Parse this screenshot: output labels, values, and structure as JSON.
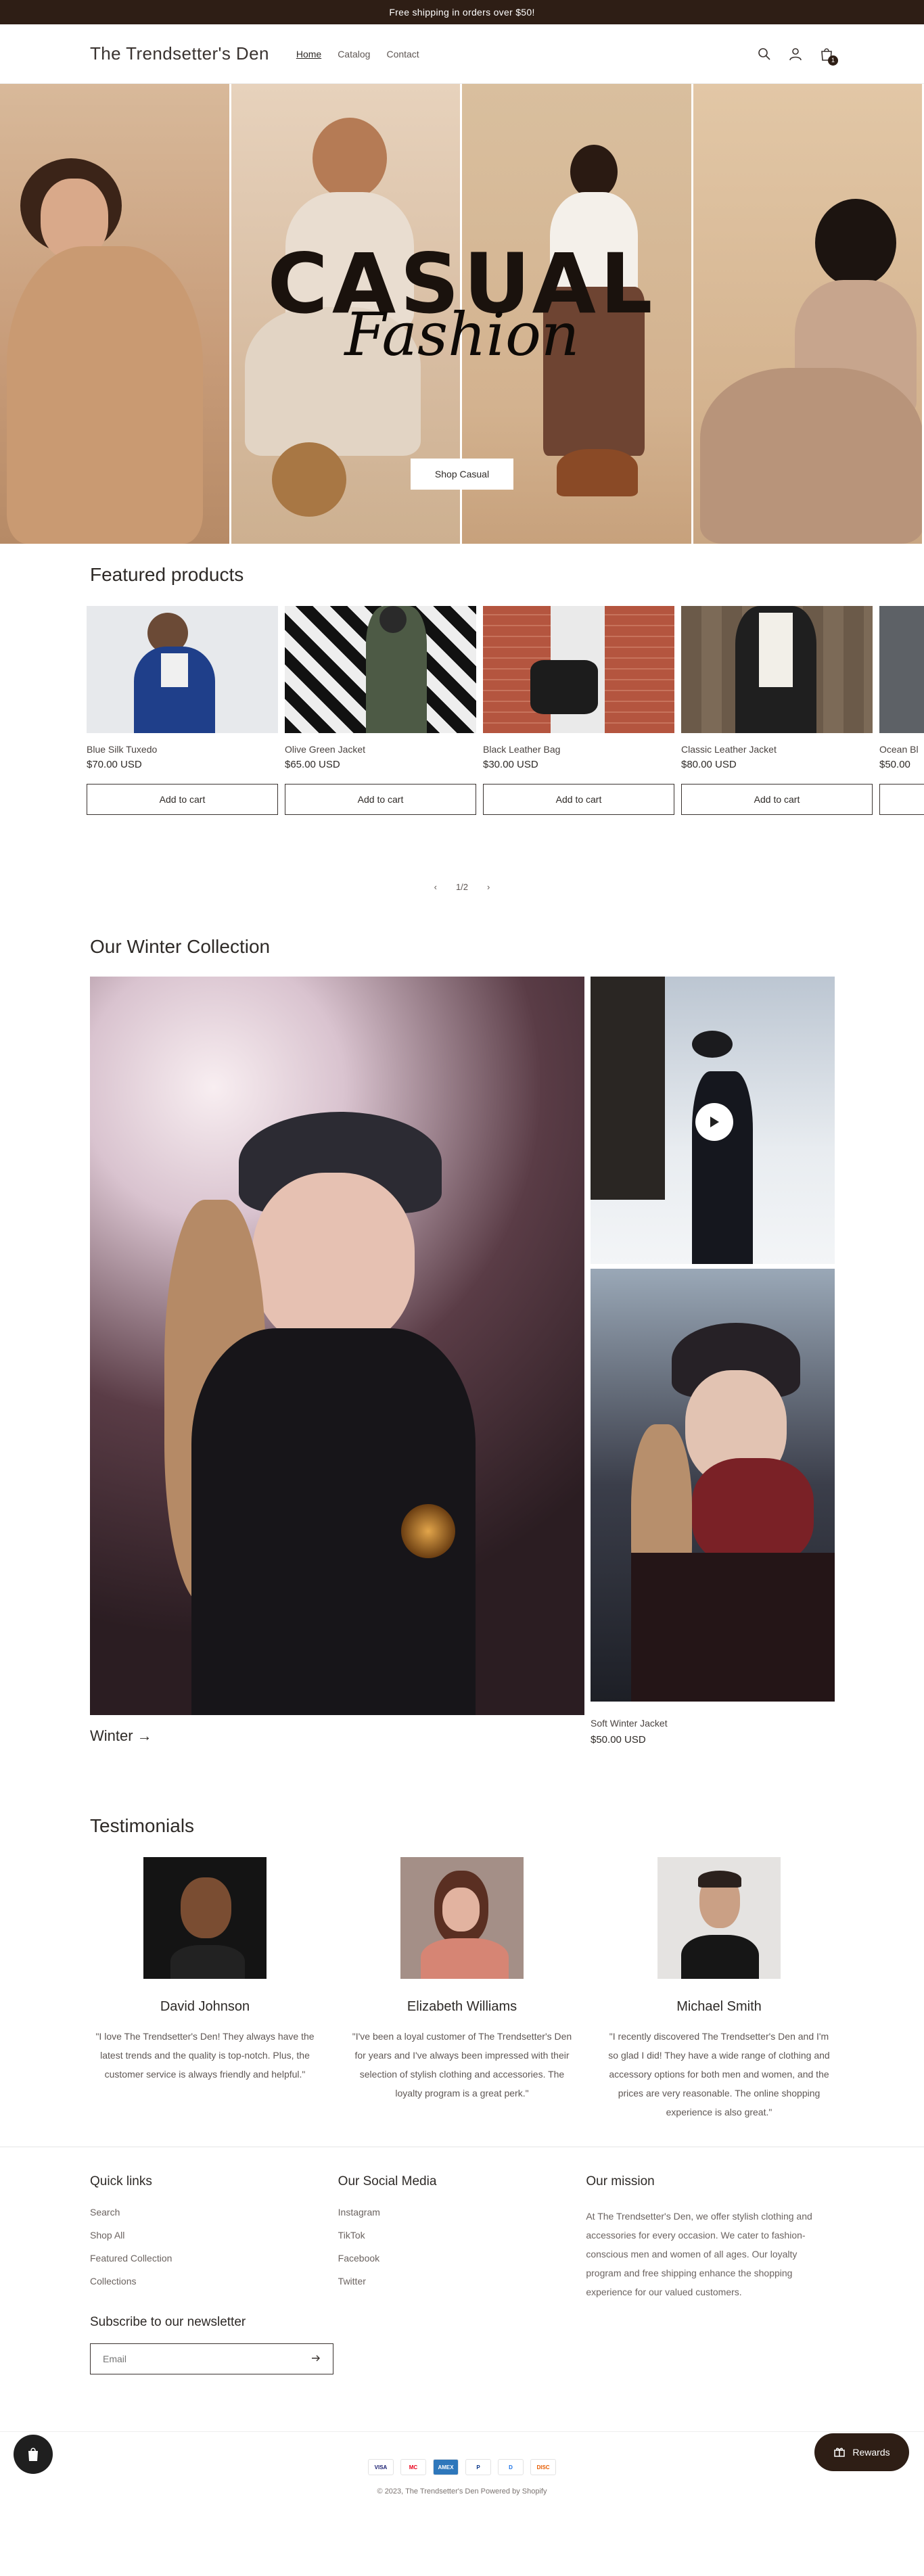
{
  "announcement": "Free shipping in orders over $50!",
  "header": {
    "brand": "The Trendsetter's Den",
    "nav": [
      "Home",
      "Catalog",
      "Contact"
    ],
    "cart_count": "1"
  },
  "hero": {
    "title": "CASUAL",
    "script": "Fashion",
    "button": "Shop Casual"
  },
  "featured": {
    "title": "Featured products",
    "products": [
      {
        "name": "Blue Silk Tuxedo",
        "price": "$70.00 USD",
        "button": "Add to cart"
      },
      {
        "name": "Olive Green Jacket",
        "price": "$65.00 USD",
        "button": "Add to cart"
      },
      {
        "name": "Black Leather Bag",
        "price": "$30.00 USD",
        "button": "Add to cart"
      },
      {
        "name": "Classic Leather Jacket",
        "price": "$80.00 USD",
        "button": "Add to cart"
      },
      {
        "name": "Ocean Bl",
        "price": "$50.00",
        "button": ""
      }
    ],
    "pager": "1/2"
  },
  "winter": {
    "title": "Our Winter Collection",
    "link": "Winter →",
    "product_name": "Soft Winter Jacket",
    "product_price": "$50.00 USD"
  },
  "testimonials": {
    "title": "Testimonials",
    "items": [
      {
        "name": "David Johnson",
        "quote": "\"I love The Trendsetter's Den! They always have the latest trends and the quality is top-notch. Plus, the customer service is always friendly and helpful.\""
      },
      {
        "name": "Elizabeth Williams",
        "quote": "\"I've been a loyal customer of The Trendsetter's Den for years and I've always been impressed with their selection of stylish clothing and accessories. The loyalty program is a great perk.\""
      },
      {
        "name": "Michael Smith",
        "quote": "\"I recently discovered The Trendsetter's Den and I'm so glad I did! They have a wide range of clothing and accessory options for both men and women, and the prices are very reasonable. The online shopping experience is also great.\""
      }
    ]
  },
  "footer": {
    "quick_links_title": "Quick links",
    "quick_links": [
      "Search",
      "Shop All",
      "Featured Collection",
      "Collections"
    ],
    "social_title": "Our Social Media",
    "social": [
      "Instagram",
      "TikTok",
      "Facebook",
      "Twitter"
    ],
    "mission_title": "Our mission",
    "mission": "At The Trendsetter's Den, we offer stylish clothing and accessories for every occasion. We cater to fashion-conscious men and women of all ages. Our loyalty program and free shipping enhance the shopping experience for our valued customers.",
    "newsletter_title": "Subscribe to our newsletter",
    "email_placeholder": "Email",
    "payments": [
      "VISA",
      "MC",
      "AMEX",
      "P",
      "D",
      "DISC"
    ],
    "copyright": "© 2023, The Trendsetter's Den Powered by Shopify",
    "rewards": "Rewards"
  }
}
